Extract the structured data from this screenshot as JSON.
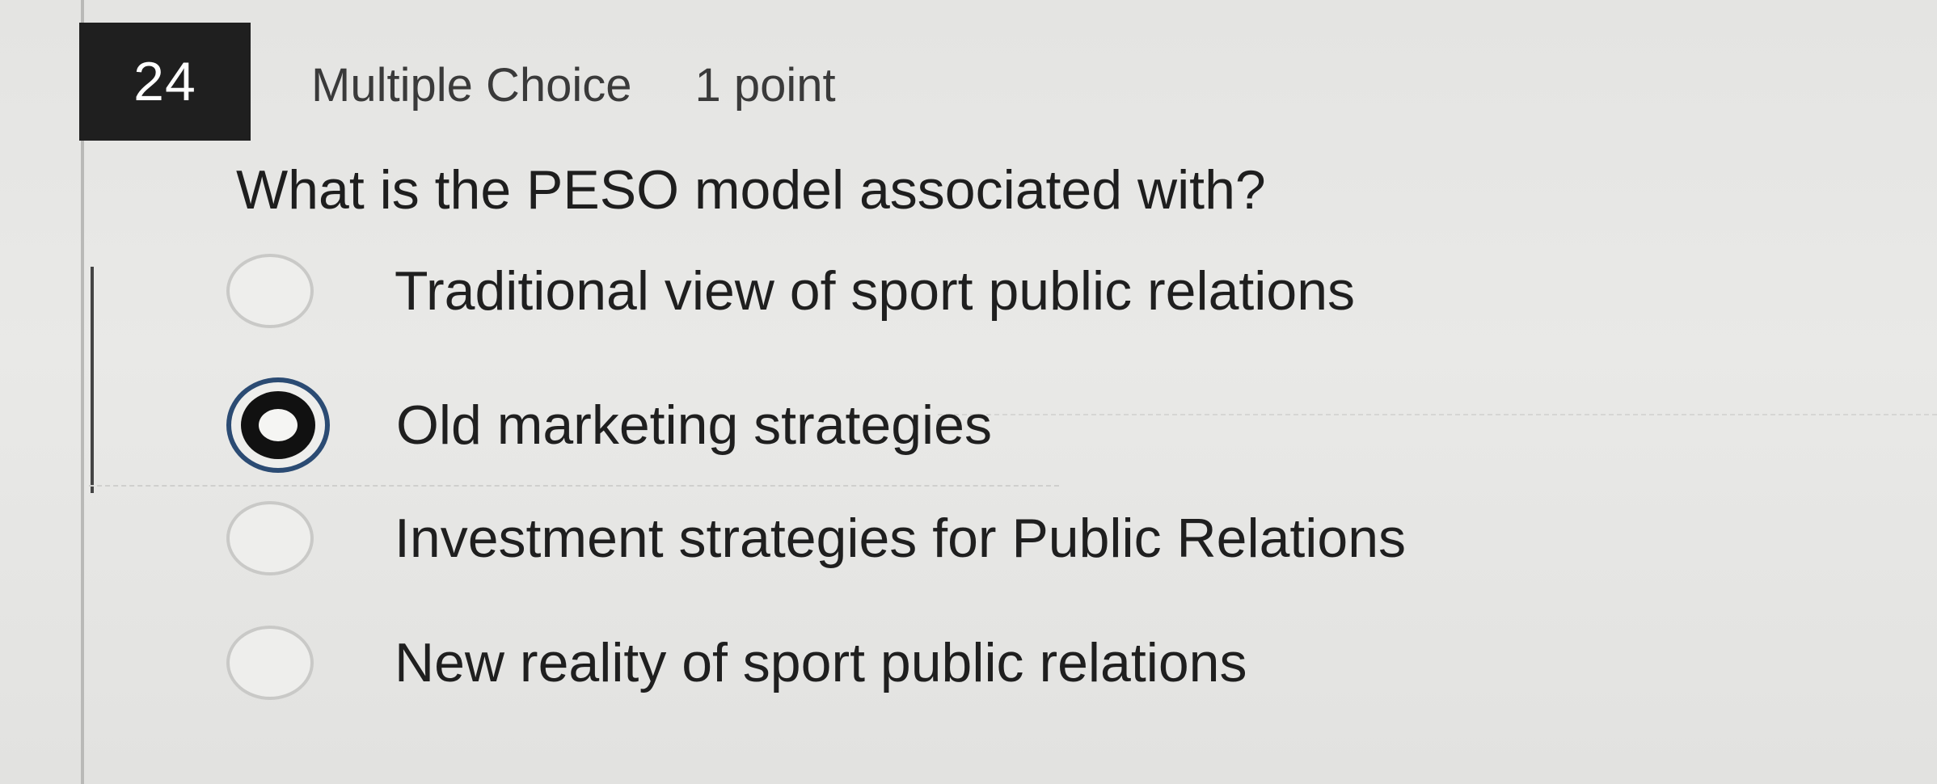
{
  "question": {
    "number": "24",
    "type": "Multiple Choice",
    "points": "1 point",
    "text": "What is the PESO model associated with?",
    "options": [
      {
        "label": "Traditional view of sport public relations",
        "selected": false
      },
      {
        "label": "Old marketing strategies",
        "selected": true
      },
      {
        "label": "Investment strategies for Public Relations",
        "selected": false
      },
      {
        "label": "New reality of sport public relations",
        "selected": false
      }
    ]
  },
  "colors": {
    "number_box_bg": "#1f1f1f",
    "selected_ring": "#2b4b73",
    "page_bg": "#e6e6e4"
  }
}
